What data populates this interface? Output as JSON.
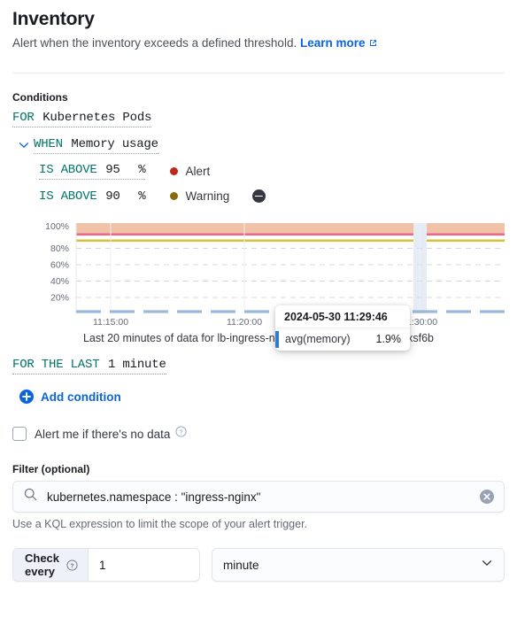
{
  "header": {
    "title": "Inventory",
    "description": "Alert when the inventory exceeds a defined threshold.",
    "learn_more": "Learn more",
    "learn_more_icon": "external-link-icon"
  },
  "conditions": {
    "section_label": "Conditions",
    "for_keyword": "FOR",
    "for_value": "Kubernetes Pods",
    "when_keyword": "WHEN",
    "when_value": "Memory usage",
    "expand_icon": "chevron-down-icon",
    "thresholds": [
      {
        "comparator": "IS ABOVE",
        "value": "95",
        "unit": "%",
        "severity": "Alert",
        "severity_color": "#bd271e",
        "removable": false
      },
      {
        "comparator": "IS ABOVE",
        "value": "90",
        "unit": "%",
        "severity": "Warning",
        "severity_color": "#8a6a0a",
        "removable": true,
        "remove_icon": "minus-circle-icon"
      }
    ],
    "for_the_last_keyword": "FOR THE LAST",
    "for_the_last_value": "1 minute",
    "add_condition_label": "Add condition",
    "add_condition_icon": "plus-circle-icon",
    "no_data_label": "Alert me if there's no data",
    "no_data_checked": false,
    "no_data_help_icon": "question-circle-icon"
  },
  "chart_data": {
    "type": "line",
    "title": "",
    "caption": "Last 20 minutes of data for lb-ingress-nginx-controller-64b6b4f75f-xsf6b",
    "xlabel": "",
    "ylabel": "",
    "ylim": [
      0,
      108
    ],
    "yticks": [
      "20%",
      "40%",
      "60%",
      "80%",
      "100%"
    ],
    "ytick_values": [
      20,
      40,
      60,
      80,
      100
    ],
    "xticks": [
      "11:15:00",
      "11:20:00",
      "11:30:00"
    ],
    "xtick_positions": [
      0.08,
      0.39,
      0.855
    ],
    "grid": "dashed-horizontal",
    "legend": "none",
    "series": [
      {
        "name": "avg(memory)",
        "color": "#98b9dd",
        "style": "dashed",
        "values": [
          1.9,
          1.9,
          1.9,
          1.9,
          1.9,
          1.9,
          1.9,
          1.9,
          1.9,
          1.9,
          1.9,
          1.9,
          1.9,
          1.9,
          1.9,
          1.9,
          1.9,
          1.9,
          1.9,
          1.9
        ]
      }
    ],
    "annotations": {
      "alert_threshold": 95,
      "alert_threshold_color": "#e7698e",
      "alert_band_color": "#f0c3a8",
      "warning_threshold": 90,
      "warning_threshold_color": "#d6c13c",
      "cursor_position": 0.79,
      "cursor_color": "#e6ecf5"
    },
    "tooltip": {
      "timestamp": "2024-05-30 11:29:46",
      "series_name": "avg(memory)",
      "value": "1.9%",
      "swatch_color": "#2a7fd4"
    }
  },
  "filter": {
    "label": "Filter (optional)",
    "search_icon": "search-icon",
    "value": "kubernetes.namespace : \"ingress-nginx\"",
    "placeholder": "",
    "clear_icon": "clear-circle-icon",
    "help": "Use a KQL expression to limit the scope of your alert trigger."
  },
  "check_every": {
    "label": "Check every",
    "help_icon": "question-circle-icon",
    "amount": "1",
    "unit": "minute",
    "unit_chevron_icon": "chevron-down-icon"
  }
}
